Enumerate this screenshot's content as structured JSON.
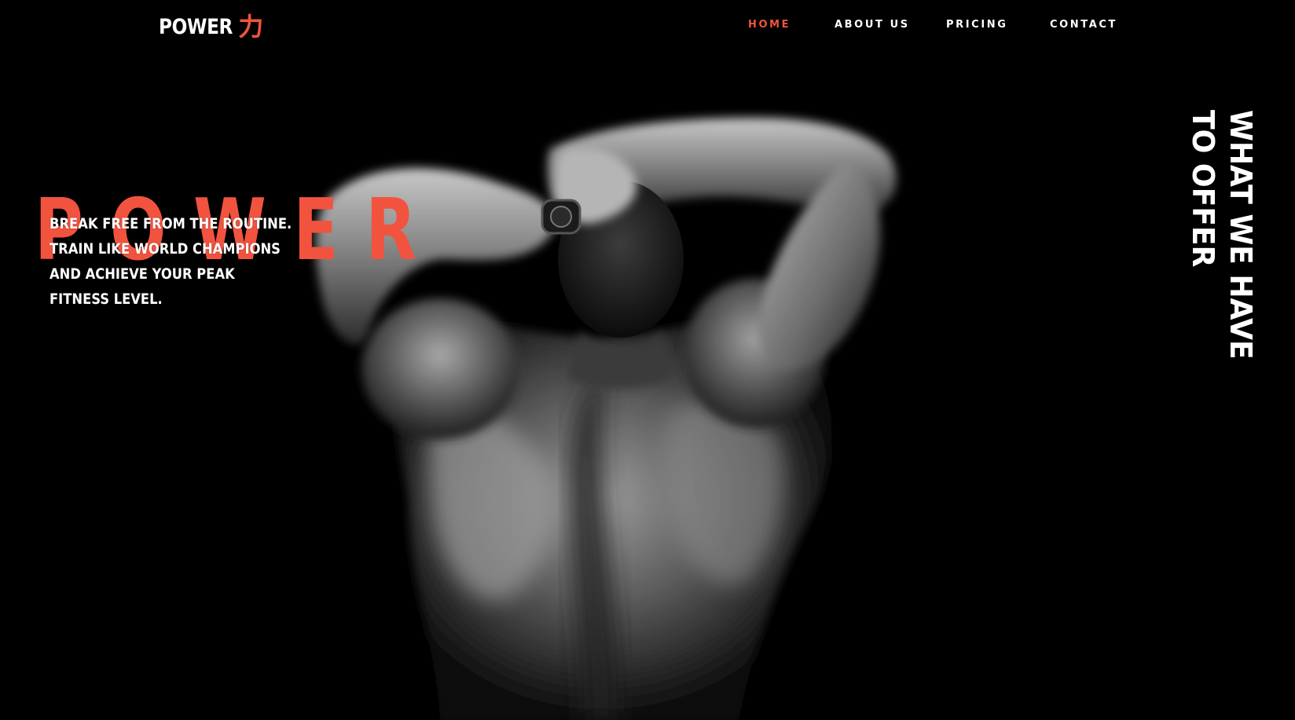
{
  "brand": {
    "name": "POWER",
    "kanji": "力"
  },
  "nav": {
    "items": [
      {
        "label": "HOME",
        "active": true
      },
      {
        "label": "ABOUT US",
        "active": false
      },
      {
        "label": "PRICING",
        "active": false
      },
      {
        "label": "CONTACT",
        "active": false
      }
    ]
  },
  "hero": {
    "title": "POWER",
    "tagline": "BREAK FREE FROM THE ROUTINE. TRAIN LIKE WORLD CHAMPIONS AND ACHIEVE YOUR PEAK FITNESS LEVEL.",
    "image": "muscular-man-back-photo"
  },
  "side": {
    "line1": "WHAT WE HAVE",
    "line2": "TO OFFER"
  },
  "colors": {
    "background": "#000000",
    "accent": "#f2533f",
    "text": "#ffffff"
  }
}
